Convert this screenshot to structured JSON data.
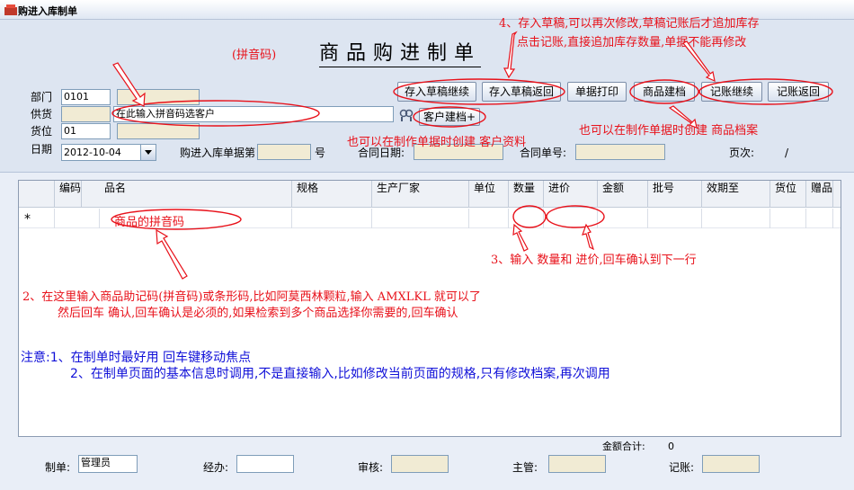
{
  "window": {
    "title": "购进入库制单"
  },
  "document_title": "商品购进制单",
  "form": {
    "dept_label": "部门",
    "dept_code": "0101",
    "supplier_label": "供货",
    "supplier_placeholder": "在此输入拼音码选客户",
    "location_label": "货位",
    "location_code": "01",
    "date_label": "日期",
    "date_value": "2012-10-04",
    "doc_no_label": "购进入库单据第",
    "doc_no_suffix": "号",
    "contract_date_label": "合同日期:",
    "contract_no_label": "合同单号:",
    "page_label": "页次:",
    "page_value": "/"
  },
  "toolbar": {
    "save_draft_continue": "存入草稿继续",
    "save_draft_return": "存入草稿返回",
    "print_doc": "单据打印",
    "create_product": "商品建档",
    "post_continue": "记账继续",
    "post_return": "记账返回",
    "create_customer": "客户建档+"
  },
  "grid": {
    "columns": [
      "编码",
      "品名",
      "规格",
      "生产厂家",
      "单位",
      "数量",
      "进价",
      "金额",
      "批号",
      "效期至",
      "货位",
      "赠品"
    ],
    "new_row_marker": "*"
  },
  "footer": {
    "total_label": "金额合计:",
    "total_value": "0",
    "maker_label": "制单:",
    "maker_value": "管理员",
    "handler_label": "经办:",
    "reviewer_label": "审核:",
    "supervisor_label": "主管:",
    "bookkeeper_label": "记账:"
  },
  "annotations": {
    "pinyin_code": "(拼音码)",
    "step4_line1": "4、存入草稿,可以再次修改,草稿记账后才追加库存",
    "step4_line2": "点击记账,直接追加库存数量,单据不能再修改",
    "create_product_hint": "也可以在制作单据时创建 商品档案",
    "create_customer_hint": "也可以在制作单据时创建 客户资料",
    "product_pinyin": "商品的拼音码",
    "step3": "3、输入 数量和 进价,回车确认到下一行",
    "step2_line1": "2、在这里输入商品助记码(拼音码)或条形码,比如阿莫西林颗粒,输入 AMXLKL 就可以了",
    "step2_line2": "然后回车 确认,回车确认是必须的,如果检索到多个商品选择你需要的,回车确认"
  },
  "notes": {
    "line1": "注意:1、在制单时最好用  回车键移动焦点",
    "line2": "2、在制单页面的基本信息时调用,不是直接输入,比如修改当前页面的规格,只有修改档案,再次调用"
  },
  "colors": {
    "annotation": "#e8111a",
    "note": "#1010d8",
    "readonly_field": "#f1ebd4",
    "panel": "#dde5f1"
  }
}
